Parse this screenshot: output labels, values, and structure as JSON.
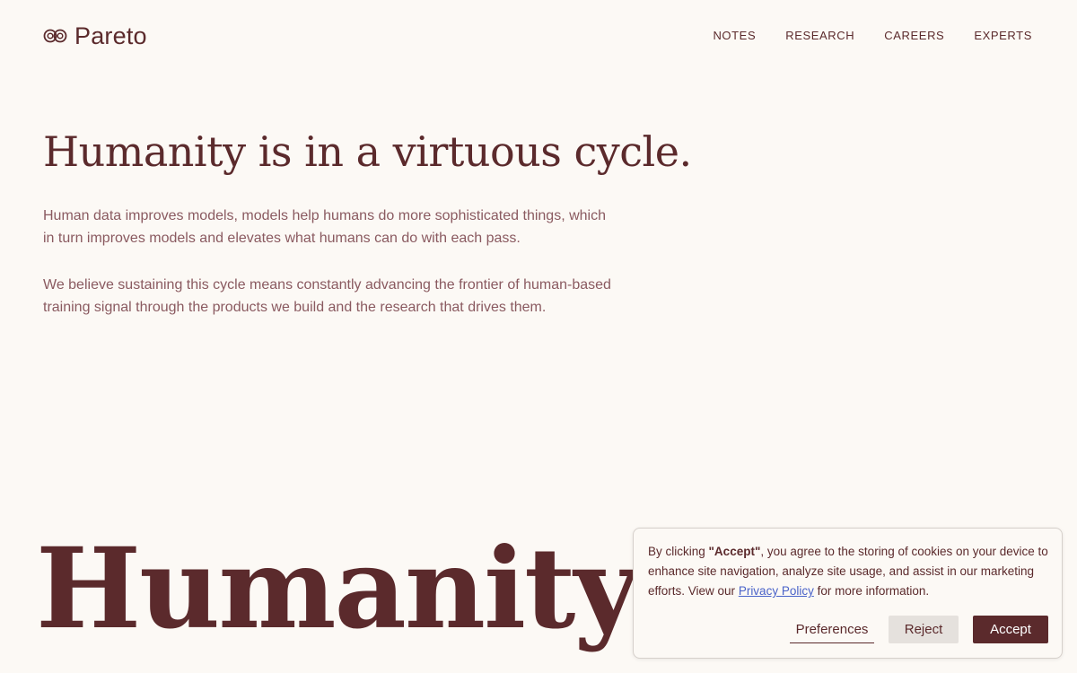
{
  "header": {
    "logo_text": "Pareto",
    "logo_icon": "infinity-loop-icon",
    "nav": [
      {
        "label": "NOTES"
      },
      {
        "label": "RESEARCH"
      },
      {
        "label": "CAREERS"
      },
      {
        "label": "EXPERTS"
      }
    ]
  },
  "hero": {
    "title": "Humanity is in a virtuous cycle.",
    "paragraph_1": "Human data improves models, models help humans do more sophisticated things, which in turn improves models and elevates what humans can do with each pass.",
    "paragraph_2": "We believe sustaining this cycle means constantly advancing the frontier of human-based training signal through the products we build and the research that drives them."
  },
  "section": {
    "big_heading": "Humanity to"
  },
  "cookie": {
    "text_before": "By clicking ",
    "accept_quote": "\"Accept\"",
    "text_middle": ", you agree to the storing of cookies on your device to enhance site navigation, analyze site usage, and assist in our marketing efforts. View our ",
    "privacy_link": "Privacy Policy",
    "text_after": " for more information.",
    "preferences_label": "Preferences",
    "reject_label": "Reject",
    "accept_label": "Accept"
  },
  "colors": {
    "background": "#fcf9f5",
    "brand": "#5b2a2c",
    "body_text": "#8a5a60",
    "link": "#4a63c9",
    "reject_bg": "#e5e1dd"
  }
}
